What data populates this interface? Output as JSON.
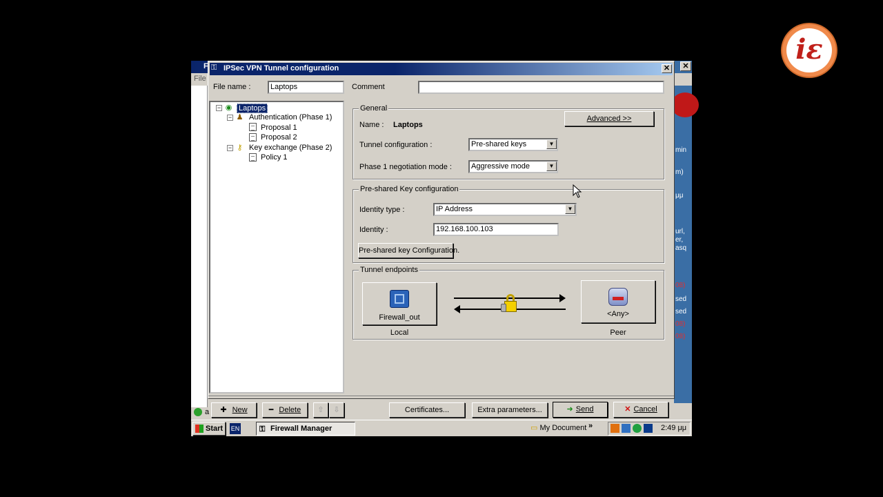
{
  "logo": {
    "text": "iε"
  },
  "background_app": {
    "title": "F",
    "menu_first": "File",
    "status_text": "a",
    "right_texts": [
      "min",
      "m)",
      "μμ",
      "url,",
      "er,",
      "asq",
      "08)",
      "sed",
      "sed",
      "08)",
      "08)"
    ]
  },
  "dialog": {
    "title": "IPSec VPN Tunnel configuration",
    "file_name_label": "File name :",
    "file_name_value": "Laptops",
    "comment_label": "Comment",
    "comment_value": "",
    "tree": {
      "root": "Laptops",
      "phase1": "Authentication (Phase 1)",
      "proposal1": "Proposal  1",
      "proposal2": "Proposal  2",
      "phase2": "Key exchange (Phase 2)",
      "policy1": "Policy  1"
    },
    "general": {
      "legend": "General",
      "advanced_button": "Advanced >>",
      "name_label": "Name :",
      "name_value": "Laptops",
      "tunnel_config_label": "Tunnel configuration :",
      "tunnel_config_value": "Pre-shared keys",
      "negotiation_label": "Phase 1 negotiation mode :",
      "negotiation_value": "Aggressive mode"
    },
    "psk": {
      "legend": "Pre-shared Key configuration",
      "identity_type_label": "Identity type :",
      "identity_type_value": "IP Address",
      "identity_label": "Identity :",
      "identity_value": "192.168.100.103",
      "config_button": "Pre-shared key Configuration."
    },
    "endpoints": {
      "legend": "Tunnel endpoints",
      "local_name": "Firewall_out",
      "local_caption": "Local",
      "peer_name": "<Any>",
      "peer_caption": "Peer"
    },
    "buttons": {
      "new": "New",
      "delete": "Delete",
      "certificates": "Certificates...",
      "extra": "Extra parameters...",
      "send": "Send",
      "cancel": "Cancel"
    }
  },
  "taskbar": {
    "start": "Start",
    "lang": "EN",
    "app_button": "Firewall Manager",
    "my_documents": "My Document",
    "chevron": "»",
    "clock": "2:49 μμ"
  },
  "colors": {
    "title_bar": "#0a246a",
    "face": "#d4d0c8",
    "bg_accent": "#3a6ea5",
    "logo": "#f08a4b"
  }
}
